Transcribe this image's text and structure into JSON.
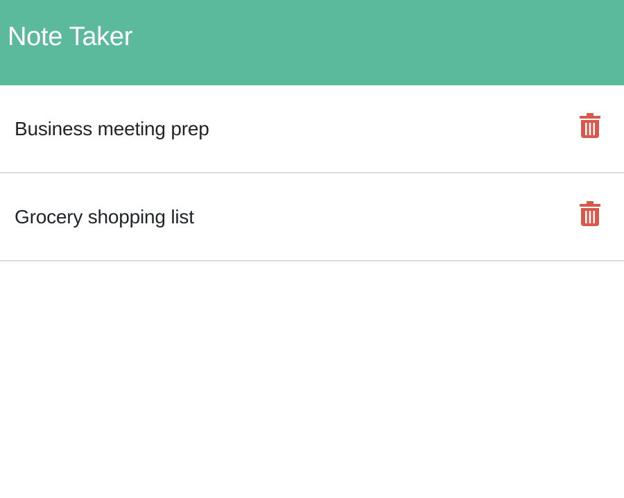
{
  "app": {
    "title": "Note Taker"
  },
  "notes": {
    "items": [
      {
        "title": "Business meeting prep",
        "delete_icon": "trash-icon"
      },
      {
        "title": "Grocery shopping list",
        "delete_icon": "trash-icon"
      }
    ]
  },
  "colors": {
    "header_background": "#5bba9b",
    "header_text": "#ffffff",
    "delete_icon": "#d9584c",
    "divider": "#dcdcdc",
    "note_text": "#212529"
  }
}
